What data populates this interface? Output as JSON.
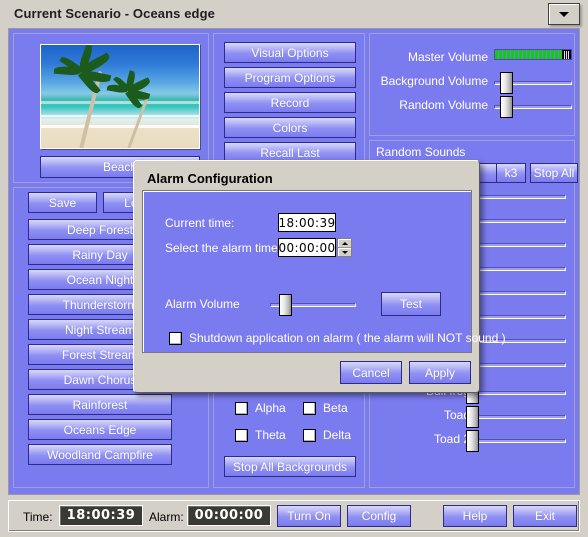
{
  "window": {
    "title": "Current Scenario - Oceans edge",
    "dropdown_icon": "chevron-down-icon"
  },
  "scene": {
    "label": "Beach",
    "image_alt": "beach-palm-trees"
  },
  "file_buttons": [
    {
      "label": "Save"
    },
    {
      "label": "Load"
    }
  ],
  "presets": [
    {
      "label": "Deep Forest"
    },
    {
      "label": "Rainy Day"
    },
    {
      "label": "Ocean Night"
    },
    {
      "label": "Thunderstorm"
    },
    {
      "label": "Night Stream"
    },
    {
      "label": "Forest Stream"
    },
    {
      "label": "Dawn Chorus"
    },
    {
      "label": "Rainforest"
    },
    {
      "label": "Oceans Edge"
    },
    {
      "label": "Woodland Campfire"
    }
  ],
  "middle_buttons": [
    {
      "label": "Visual Options"
    },
    {
      "label": "Program Options"
    },
    {
      "label": "Record"
    },
    {
      "label": "Colors"
    },
    {
      "label": "Recall Last"
    }
  ],
  "volumes": {
    "master": {
      "label": "Master Volume",
      "value": 100
    },
    "background": {
      "label": "Background Volume",
      "value": 8
    },
    "random": {
      "label": "Random Volume",
      "value": 8
    }
  },
  "random_sounds": {
    "title": "Random Sounds",
    "buttons": [
      {
        "label": ""
      },
      {
        "label": ""
      },
      {
        "label": ""
      },
      {
        "label": "k3"
      },
      {
        "label": "Stop All"
      }
    ]
  },
  "brainwaves": {
    "options": [
      {
        "label": "Alpha",
        "checked": false
      },
      {
        "label": "Beta",
        "checked": false
      },
      {
        "label": "Theta",
        "checked": false
      },
      {
        "label": "Delta",
        "checked": false
      }
    ],
    "stop_all_label": "Stop All Backgrounds"
  },
  "sound_sliders": [
    {
      "label": "",
      "value": 8
    },
    {
      "label": "",
      "value": 8
    },
    {
      "label": "",
      "value": 8
    },
    {
      "label": "",
      "value": 8
    },
    {
      "label": "",
      "value": 8
    },
    {
      "label": "",
      "value": 8
    },
    {
      "label": "",
      "value": 8
    },
    {
      "label": "",
      "value": 8
    },
    {
      "label": "Bull frog",
      "value": 8
    },
    {
      "label": "Toad",
      "value": 8
    },
    {
      "label": "Toad 2",
      "value": 8
    }
  ],
  "statusbar": {
    "time_label": "Time:",
    "time_value": "18:00:39",
    "alarm_label": "Alarm:",
    "alarm_value": "00:00:00",
    "turn_on_label": "Turn On",
    "config_label": "Config",
    "help_label": "Help",
    "exit_label": "Exit"
  },
  "dialog": {
    "title": "Alarm Configuration",
    "current_time_label": "Current time:",
    "current_time_value": "18:00:39",
    "alarm_time_label": "Select the alarm time",
    "alarm_time_value": "00:00:00",
    "alarm_volume_label": "Alarm Volume",
    "alarm_volume_value": 10,
    "test_label": "Test",
    "shutdown_label": "Shutdown application on alarm ( the alarm will NOT sound )",
    "shutdown_checked": false,
    "cancel_label": "Cancel",
    "apply_label": "Apply"
  },
  "colors": {
    "panel_blue": "#7b7bf0",
    "chrome_gray": "#d4d0c8",
    "meter_green": "#11cc11",
    "button_border": "#2b2b8a"
  }
}
